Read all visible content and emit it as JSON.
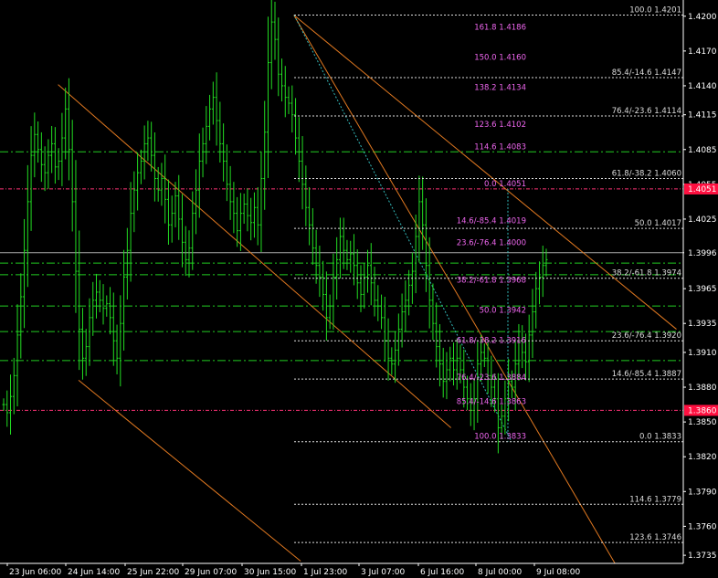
{
  "colors": {
    "background": "#000000",
    "candles": "#22dd22",
    "grid_text": "#ffffff",
    "fib_white": "#dddddd",
    "fib_magenta": "#ee66ee",
    "channel": "#e07820",
    "dashdot_green": "#22cc22",
    "magenta_line": "#ff3377",
    "cyan_dotted": "#33bbbb",
    "current_price_line": "#aaaaaa",
    "marker_red": "#ff1040",
    "marker_grey": "#bbbbbb"
  },
  "chart_data": {
    "type": "candlestick",
    "symbol_series": "price",
    "y_axis": {
      "min": 1.3728,
      "max": 1.4214,
      "ticks": [
        "1.4200",
        "1.4170",
        "1.4140",
        "1.4115",
        "1.4085",
        "1.4055",
        "1.4025",
        "1.3996",
        "1.3965",
        "1.3935",
        "1.3910",
        "1.3880",
        "1.3850",
        "1.3820",
        "1.3790",
        "1.3760",
        "1.3735"
      ]
    },
    "x_axis": {
      "labels": [
        "23 Jun 06:00",
        "24 Jun 14:00",
        "25 Jun 22:00",
        "29 Jun 07:00",
        "30 Jun 15:00",
        "1 Jul 23:00",
        "3 Jul 07:00",
        "6 Jul 16:00",
        "8 Jul 00:00",
        "9 Jul 08:00"
      ]
    },
    "price_markers": [
      {
        "value": 1.3996,
        "label": "1.3996",
        "style": "current"
      },
      {
        "value": 1.4051,
        "label": "1.4051",
        "style": "red"
      },
      {
        "value": 1.386,
        "label": "1.3860",
        "style": "red"
      }
    ],
    "fib_white": [
      {
        "level": "100.0",
        "value": 1.4201
      },
      {
        "level": "85.4/-14.6",
        "value": 1.4147
      },
      {
        "level": "76.4/-23.6",
        "value": 1.4114
      },
      {
        "level": "61.8/-38.2",
        "value": 1.406
      },
      {
        "level": "50.0",
        "value": 1.4017
      },
      {
        "level": "38.2/-61.8",
        "value": 1.3974
      },
      {
        "level": "23.6/-76.4",
        "value": 1.392
      },
      {
        "level": "14.6/-85.4",
        "value": 1.3887
      },
      {
        "level": "0.0",
        "value": 1.3833
      },
      {
        "level": "114.6",
        "value": 1.3779
      },
      {
        "level": "123.6",
        "value": 1.3746
      }
    ],
    "fib_magenta": [
      {
        "level": "161.8",
        "value": 1.4186
      },
      {
        "level": "150.0",
        "value": 1.416
      },
      {
        "level": "138.2",
        "value": 1.4134
      },
      {
        "level": "123.6",
        "value": 1.4102
      },
      {
        "level": "114.6",
        "value": 1.4083
      },
      {
        "level": "0.0",
        "value": 1.4051
      },
      {
        "level": "14.6/-85.4",
        "value": 1.4019
      },
      {
        "level": "23.6/-76.4",
        "value": 1.4
      },
      {
        "level": "38.2/-61.8",
        "value": 1.3968
      },
      {
        "level": "50.0",
        "value": 1.3942
      },
      {
        "level": "61.8/-38.2",
        "value": 1.3916
      },
      {
        "level": "76.4/-23.6",
        "value": 1.3884
      },
      {
        "level": "85.4/-14.6",
        "value": 1.3863
      },
      {
        "level": "100.0",
        "value": 1.3833
      }
    ],
    "horizontal_levels_green": [
      1.4083,
      1.3987,
      1.3977,
      1.395,
      1.3928,
      1.3903
    ],
    "horizontal_level_magenta": [
      1.4051,
      1.386
    ],
    "closes": [
      1.3865,
      1.3858,
      1.3872,
      1.389,
      1.3925,
      1.3958,
      1.3998,
      1.404,
      1.408,
      1.4098,
      1.4085,
      1.4072,
      1.4065,
      1.408,
      1.409,
      1.407,
      1.4075,
      1.4095,
      1.412,
      1.4085,
      1.404,
      1.398,
      1.393,
      1.3905,
      1.3915,
      1.394,
      1.3955,
      1.3962,
      1.3955,
      1.3948,
      1.3952,
      1.394,
      1.392,
      1.3905,
      1.3935,
      1.3975,
      1.3998,
      1.403,
      1.405,
      1.4065,
      1.4075,
      1.409,
      1.4095,
      1.408,
      1.406,
      1.405,
      1.406,
      1.4042,
      1.402,
      1.403,
      1.4045,
      1.4025,
      1.4005,
      1.399,
      1.4,
      1.403,
      1.405,
      1.4075,
      1.409,
      1.4105,
      1.412,
      1.413,
      1.411,
      1.409,
      1.4075,
      1.4055,
      1.404,
      1.403,
      1.4015,
      1.403,
      1.4038,
      1.4028,
      1.4022,
      1.4035,
      1.402,
      1.406,
      1.41,
      1.416,
      1.4195,
      1.418,
      1.415,
      1.414,
      1.413,
      1.4125,
      1.4115,
      1.4095,
      1.4075,
      1.4055,
      1.4035,
      1.402,
      1.4,
      1.3985,
      1.3975,
      1.396,
      1.394,
      1.395,
      1.3975,
      1.399,
      1.401,
      1.3998,
      1.399,
      1.3995,
      1.3985,
      1.397,
      1.396,
      1.3975,
      1.3985,
      1.397,
      1.3955,
      1.395,
      1.394,
      1.392,
      1.3905,
      1.39,
      1.3912,
      1.393,
      1.3945,
      1.3955,
      1.3968,
      1.398,
      1.401,
      1.404,
      1.402,
      1.3985,
      1.3955,
      1.3935,
      1.3915,
      1.39,
      1.3885,
      1.3895,
      1.3905,
      1.3895,
      1.3905,
      1.3895,
      1.388,
      1.387,
      1.386,
      1.387,
      1.39,
      1.391,
      1.3905,
      1.389,
      1.388,
      1.387,
      1.3845,
      1.3855,
      1.387,
      1.3885,
      1.388,
      1.39,
      1.392,
      1.391,
      1.3902,
      1.3925,
      1.3945,
      1.3965,
      1.3975,
      1.3985,
      1.399
    ],
    "channel_lines": [
      {
        "x1_frac": 0.085,
        "y1": 1.4141,
        "x2_frac": 0.66,
        "y2": 1.3845
      },
      {
        "x1_frac": 0.115,
        "y1": 1.3886,
        "x2_frac": 0.44,
        "y2": 1.373
      },
      {
        "x1_frac": 0.43,
        "y1": 1.4201,
        "x2_frac": 0.99,
        "y2": 1.393
      },
      {
        "x1_frac": 0.43,
        "y1": 1.4201,
        "x2_frac": 0.9,
        "y2": 1.3728
      }
    ]
  }
}
